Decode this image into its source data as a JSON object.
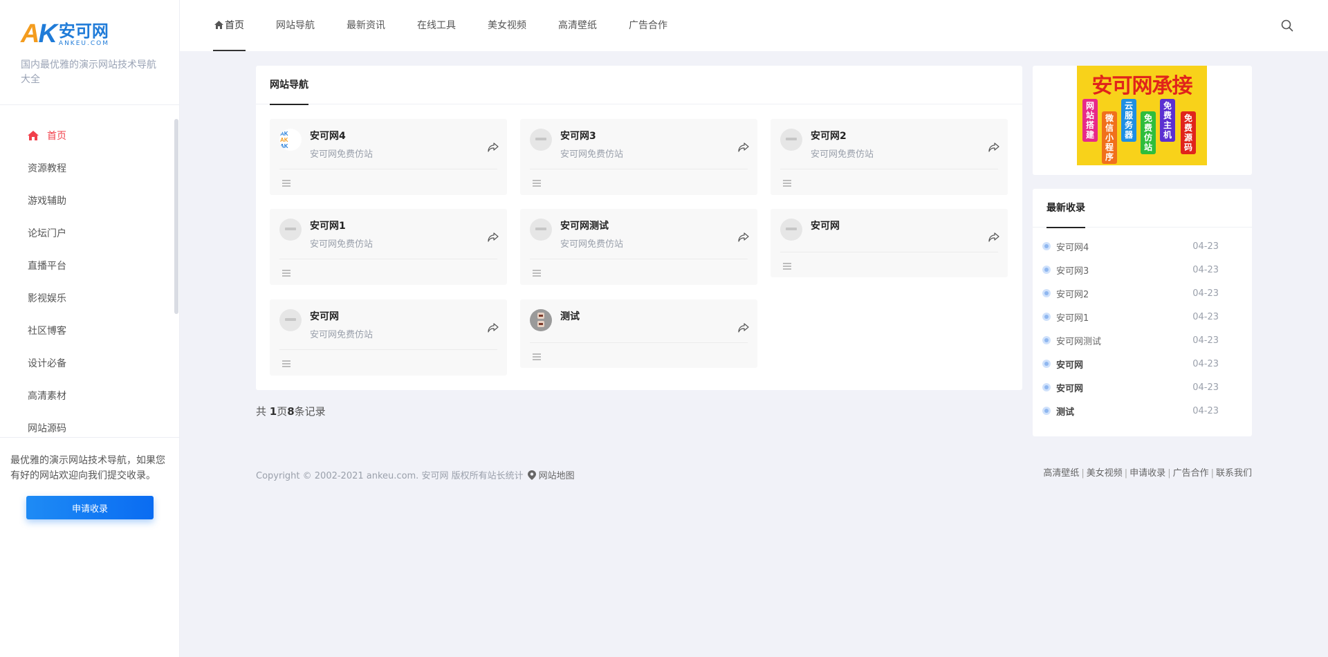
{
  "logo": {
    "ak_a": "A",
    "ak_k": "K",
    "cn": "安可网",
    "en": "ANKEU.COM"
  },
  "slogan": "国内最优雅的演示网站技术导航大全",
  "sidebar": {
    "items": [
      {
        "label": "首页"
      },
      {
        "label": "资源教程"
      },
      {
        "label": "游戏辅助"
      },
      {
        "label": "论坛门户"
      },
      {
        "label": "直播平台"
      },
      {
        "label": "影视娱乐"
      },
      {
        "label": "社区博客"
      },
      {
        "label": "设计必备"
      },
      {
        "label": "高清素材"
      },
      {
        "label": "网站源码"
      }
    ],
    "promo_text": "最优雅的演示网站技术导航，如果您有好的网站欢迎向我们提交收录。",
    "apply_button": "申请收录"
  },
  "nav": {
    "items": [
      {
        "label": "首页"
      },
      {
        "label": "网站导航"
      },
      {
        "label": "最新资讯"
      },
      {
        "label": "在线工具"
      },
      {
        "label": "美女视频"
      },
      {
        "label": "高清壁纸"
      },
      {
        "label": "广告合作"
      }
    ],
    "search_icon": "search-icon"
  },
  "main": {
    "tab_title": "网站导航",
    "sites": [
      {
        "name": "安可网4",
        "desc": "安可网免费仿站"
      },
      {
        "name": "安可网3",
        "desc": "安可网免费仿站"
      },
      {
        "name": "安可网2",
        "desc": "安可网免费仿站"
      },
      {
        "name": "安可网1",
        "desc": "安可网免费仿站"
      },
      {
        "name": "安可网测试",
        "desc": "安可网免费仿站"
      },
      {
        "name": "安可网",
        "desc": ""
      },
      {
        "name": "安可网",
        "desc": "安可网免费仿站"
      },
      {
        "name": "测试",
        "desc": ""
      }
    ],
    "pager": {
      "prefix": "共 ",
      "pages": "1",
      "mid": "页",
      "records": "8",
      "suffix": "条记录"
    }
  },
  "ad": {
    "title": "安可网承接",
    "tags": [
      "网站搭建",
      "微信小程序",
      "云服务器",
      "免费仿站",
      "免费主机",
      "免费源码"
    ]
  },
  "recent": {
    "title": "最新收录",
    "items": [
      {
        "name": "安可网4",
        "date": "04-23"
      },
      {
        "name": "安可网3",
        "date": "04-23"
      },
      {
        "name": "安可网2",
        "date": "04-23"
      },
      {
        "name": "安可网1",
        "date": "04-23"
      },
      {
        "name": "安可网测试",
        "date": "04-23"
      },
      {
        "name": "安可网",
        "date": "04-23"
      },
      {
        "name": "安可网",
        "date": "04-23"
      },
      {
        "name": "测试",
        "date": "04-23"
      }
    ]
  },
  "footer": {
    "copyright": "Copyright © 2002-2021 ankeu.com. 安可网 版权所有站长统计",
    "sitemap": "网站地图",
    "links": [
      "高清壁纸",
      "美女视频",
      "申请收录",
      "广告合作",
      "联系我们"
    ],
    "separator": "|"
  },
  "colors": {
    "accent": "#f1404b",
    "primary": "#0a6cf2",
    "background": "#f1f2f8"
  }
}
